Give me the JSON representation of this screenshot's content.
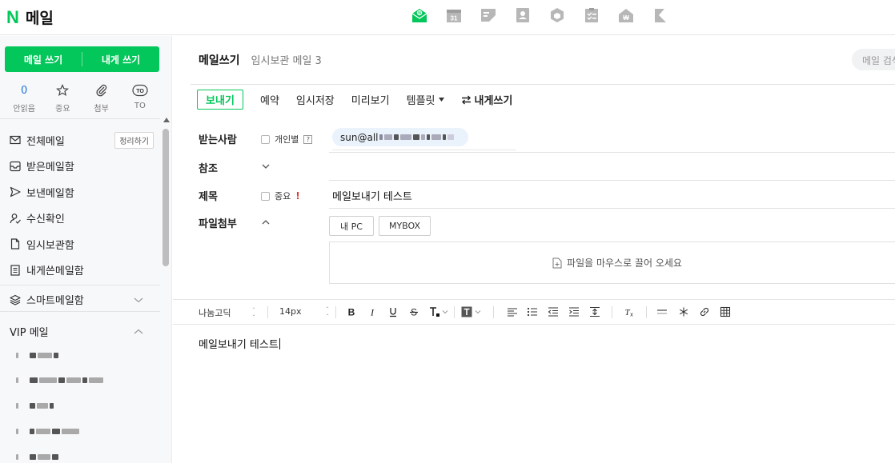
{
  "app": {
    "logo_n": "N",
    "title": "메일"
  },
  "header": {
    "apps": [
      "mail-app-icon",
      "calendar-icon",
      "memo-icon",
      "contacts-icon",
      "cube-icon",
      "checklist-icon",
      "home-icon",
      "bookmark-icon"
    ],
    "calendar_day": "31",
    "active_color": "#03c75a"
  },
  "sidebar": {
    "compose_label": "메일 쓰기",
    "self_compose_label": "내게 쓰기",
    "quick": [
      {
        "value": "0",
        "label": "안읽음"
      },
      {
        "label": "중요"
      },
      {
        "label": "첨부"
      },
      {
        "badge": "TO",
        "label": "TO"
      }
    ],
    "items": [
      {
        "label": "전체메일",
        "action": "정리하기"
      },
      {
        "label": "받은메일함"
      },
      {
        "label": "보낸메일함"
      },
      {
        "label": "수신확인"
      },
      {
        "label": "임시보관함"
      },
      {
        "label": "내게쓴메일함"
      }
    ],
    "smart_mailbox": "스마트메일함",
    "vip_title": "VIP 메일"
  },
  "main": {
    "title": "메일쓰기",
    "draft_label": "임시보관 메일 3",
    "search_placeholder": "메일 검색",
    "toolbar": {
      "send": "보내기",
      "schedule": "예약",
      "save_draft": "임시저장",
      "preview": "미리보기",
      "template": "템플릿",
      "self_compose": "내게쓰기"
    },
    "fields": {
      "to_label": "받는사람",
      "individual_label": "개인별",
      "help_mark": "?",
      "recipient_prefix": "sun@all",
      "cc_label": "참조",
      "subject_label": "제목",
      "important_label": "중요",
      "important_mark": "!",
      "subject_value": "메일보내기 테스트",
      "attach_label": "파일첨부",
      "my_pc": "내 PC",
      "mybox": "MYBOX",
      "drop_hint": "파일을 마우스로 끌어 오세요"
    },
    "editor": {
      "font": "나눔고딕",
      "size": "14px",
      "body": "메일보내기 테스트"
    }
  }
}
